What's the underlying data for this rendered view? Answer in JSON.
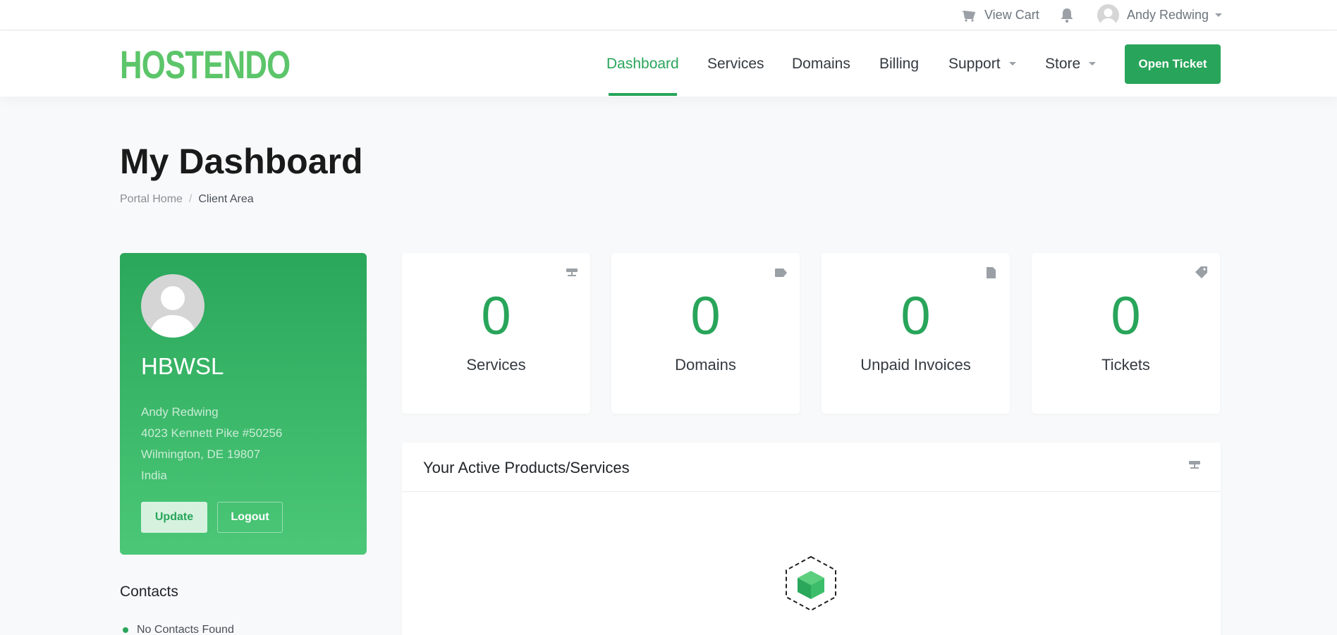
{
  "topbar": {
    "cart_label": "View Cart",
    "user_name": "Andy Redwing"
  },
  "brand": {
    "logo_text": "HOSTENDO"
  },
  "nav": {
    "items": [
      {
        "label": "Dashboard",
        "active": true
      },
      {
        "label": "Services"
      },
      {
        "label": "Domains"
      },
      {
        "label": "Billing"
      },
      {
        "label": "Support",
        "dropdown": true
      },
      {
        "label": "Store",
        "dropdown": true
      }
    ],
    "cta_label": "Open Ticket"
  },
  "page": {
    "title": "My Dashboard",
    "breadcrumb": [
      "Portal Home",
      "Client Area"
    ]
  },
  "profile": {
    "company": "HBWSL",
    "address_lines": [
      "Andy Redwing",
      "4023 Kennett Pike #50256",
      "Wilmington, DE 19807",
      "India"
    ],
    "update_label": "Update",
    "logout_label": "Logout"
  },
  "stats": [
    {
      "value": "0",
      "label": "Services",
      "icon": "server-icon"
    },
    {
      "value": "0",
      "label": "Domains",
      "icon": "tag-icon"
    },
    {
      "value": "0",
      "label": "Unpaid Invoices",
      "icon": "file-icon"
    },
    {
      "value": "0",
      "label": "Tickets",
      "icon": "ticket-icon"
    }
  ],
  "contacts": {
    "title": "Contacts",
    "empty": "No Contacts Found"
  },
  "products_panel": {
    "title": "Your Active Products/Services"
  },
  "colors": {
    "accent": "#28a55a",
    "logo": "#5cc56a",
    "card_gradient_top": "#2aa75b",
    "card_gradient_bottom": "#4bc777"
  }
}
